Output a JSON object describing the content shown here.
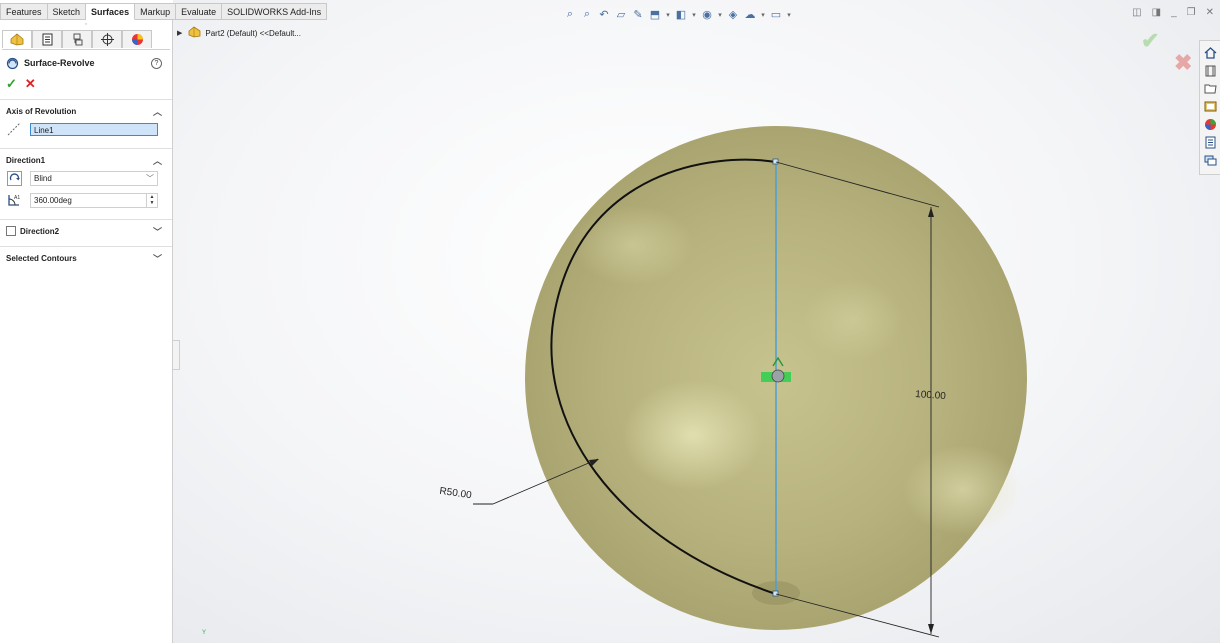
{
  "command_tabs": [
    "Features",
    "Sketch",
    "Surfaces",
    "Markup",
    "Evaluate",
    "SOLIDWORKS Add-Ins"
  ],
  "active_tab_index": 2,
  "property_manager": {
    "title": "Surface-Revolve",
    "axis_group_label": "Axis of Revolution",
    "axis_value": "Line1",
    "direction1_label": "Direction1",
    "direction1_type": "Blind",
    "direction1_angle": "360.00deg",
    "direction2_label": "Direction2",
    "selected_contours_label": "Selected Contours"
  },
  "feature_tree": {
    "root_label": "Part2 (Default) <<Default..."
  },
  "dimensions": {
    "radius_label": "R50.00",
    "length_label": "100.00"
  },
  "triad_label": "Y",
  "colors": {
    "sphere": "#b5b07a",
    "axis_line": "#4a9fd8",
    "selection": "#cfe4f8",
    "ok_green": "#2ea22e",
    "cancel_red": "#d22222"
  }
}
